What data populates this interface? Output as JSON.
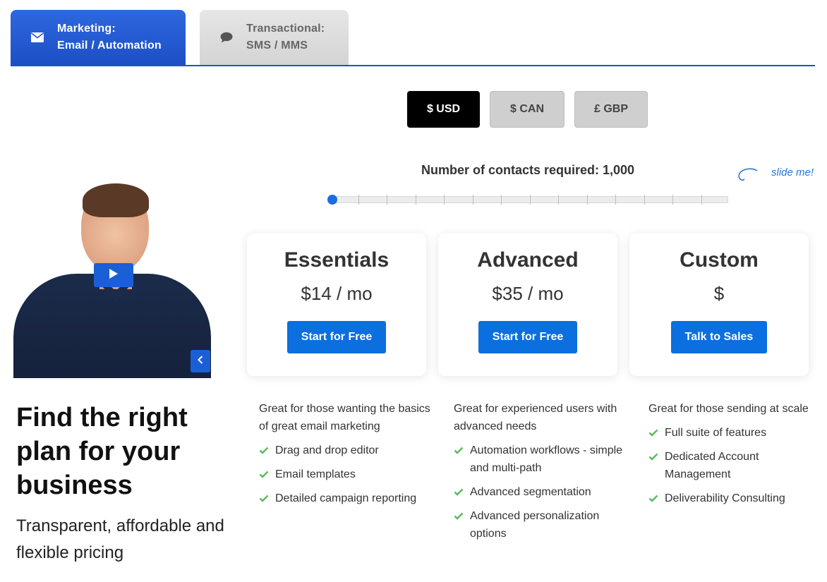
{
  "tabs": [
    {
      "line1": "Marketing:",
      "line2": "Email / Automation",
      "icon": "envelope-icon",
      "active": true
    },
    {
      "line1": "Transactional:",
      "line2": "SMS / MMS",
      "icon": "chat-bubble-icon",
      "active": false
    }
  ],
  "currency": {
    "options": [
      "$ USD",
      "$ CAN",
      "£ GBP"
    ],
    "selected": "$ USD"
  },
  "slider": {
    "label": "Number of contacts required: 1,000",
    "hint": "slide me!",
    "value": 1000,
    "position_fraction": 0
  },
  "plans": [
    {
      "name": "Essentials",
      "price": "$14 / mo",
      "button": "Start for Free",
      "description": "Great for those wanting the basics of great email marketing",
      "features": [
        "Drag and drop editor",
        "Email templates",
        "Detailed campaign reporting"
      ]
    },
    {
      "name": "Advanced",
      "price": "$35 / mo",
      "button": "Start for Free",
      "description": "Great for experienced users with advanced needs",
      "features": [
        "Automation workflows - simple and multi-path",
        "Advanced segmentation",
        "Advanced personalization options"
      ]
    },
    {
      "name": "Custom",
      "price": "$",
      "button": "Talk to Sales",
      "description": "Great for those sending at scale",
      "features": [
        "Full suite of features",
        "Dedicated Account Management",
        "Deliverability Consulting"
      ]
    }
  ],
  "headline": "Find the right plan for your business",
  "subheadline": "Transparent, affordable and flexible pricing",
  "colors": {
    "accent": "#0b6fe0",
    "tab_active": "#1d4fc4",
    "check": "#5cb85c"
  }
}
